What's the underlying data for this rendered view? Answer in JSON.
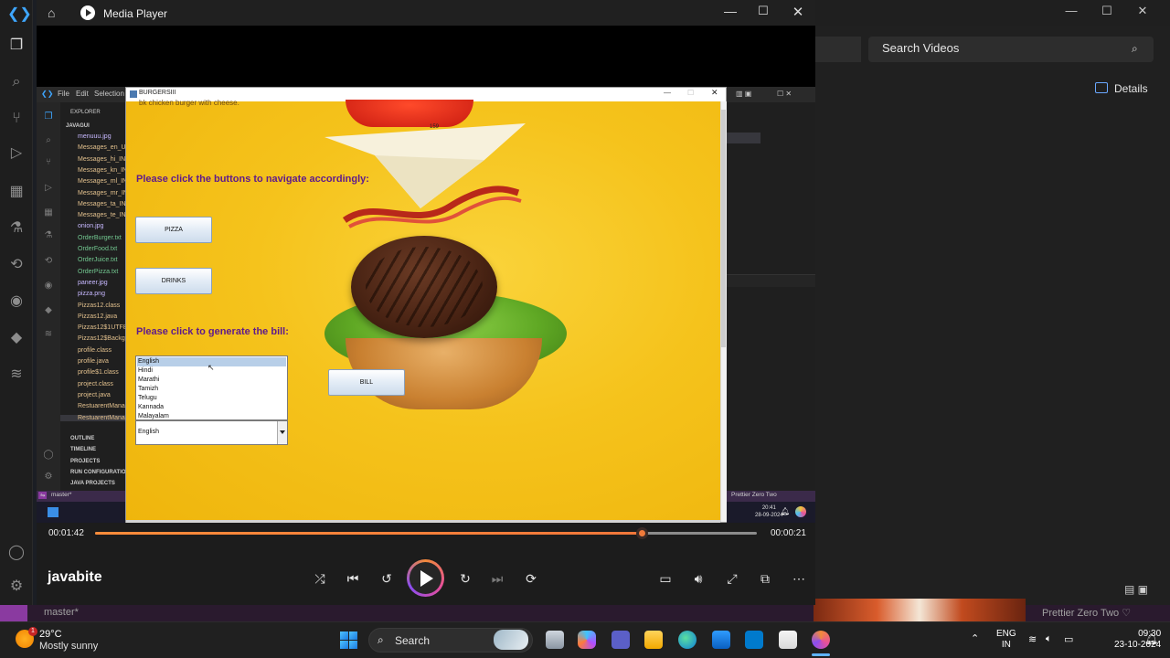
{
  "background_app": {
    "search_placeholder": "Search Videos",
    "details_label": "Details",
    "status_left": "master*",
    "status_right": "Prettier   Zero Two ♡"
  },
  "media_player": {
    "app_title": "Media Player",
    "media_title": "javabite",
    "time_current": "00:01:42",
    "time_remaining": "00:00:21",
    "progress_fraction": 0.828,
    "accent": "#f07a3a"
  },
  "video_frame": {
    "vscode": {
      "menu": [
        "File",
        "Edit",
        "Selection"
      ],
      "explorer_title": "EXPLORER",
      "root_folder": "JAVAGUI",
      "files": [
        {
          "name": "menuuu.jpg",
          "color": "#c7b8ff"
        },
        {
          "name": "Messages_en_US",
          "color": "#e2c08d"
        },
        {
          "name": "Messages_hi_IN",
          "color": "#e2c08d"
        },
        {
          "name": "Messages_kn_IN",
          "color": "#e2c08d"
        },
        {
          "name": "Messages_ml_IN",
          "color": "#e2c08d"
        },
        {
          "name": "Messages_mr_IN",
          "color": "#e2c08d"
        },
        {
          "name": "Messages_ta_IN",
          "color": "#e2c08d"
        },
        {
          "name": "Messages_te_IN",
          "color": "#e2c08d"
        },
        {
          "name": "onion.jpg",
          "color": "#c7b8ff"
        },
        {
          "name": "OrderBurger.txt",
          "color": "#73c991"
        },
        {
          "name": "OrderFood.txt",
          "color": "#73c991"
        },
        {
          "name": "OrderJuice.txt",
          "color": "#73c991"
        },
        {
          "name": "OrderPizza.txt",
          "color": "#73c991"
        },
        {
          "name": "paneer.jpg",
          "color": "#c7b8ff"
        },
        {
          "name": "pizza.png",
          "color": "#c7b8ff"
        },
        {
          "name": "Pizzas12.class",
          "color": "#e2c08d"
        },
        {
          "name": "Pizzas12.java",
          "color": "#e2c08d"
        },
        {
          "name": "Pizzas12$1UTF8",
          "color": "#e2c08d"
        },
        {
          "name": "Pizzas12$Backgr",
          "color": "#e2c08d"
        },
        {
          "name": "profile.class",
          "color": "#e2c08d"
        },
        {
          "name": "profile.java",
          "color": "#e2c08d"
        },
        {
          "name": "profile$1.class",
          "color": "#e2c08d"
        },
        {
          "name": "project.class",
          "color": "#e2c08d"
        },
        {
          "name": "project.java",
          "color": "#e2c08d"
        },
        {
          "name": "RestuarentMana",
          "color": "#e2c08d"
        },
        {
          "name": "RestuarentMana",
          "color": "#e2c08d"
        }
      ],
      "sections": [
        "OUTLINE",
        "TIMELINE",
        "PROJECTS",
        "RUN CONFIGURATIO",
        "JAVA PROJECTS"
      ],
      "status_branch": "master*",
      "status_right": "Prettier   Zero Two",
      "clock_time": "20:41",
      "clock_date": "28-09-2024"
    },
    "java_app": {
      "window_title": "BURGERSIII",
      "subtitle": "bk chicken burger with cheese.",
      "price": "159",
      "navigate_label": "Please click the buttons to navigate accordingly:",
      "pizza_button": "PIZZA",
      "drinks_button": "DRINKS",
      "bill_prompt": "Please click to generate the bill:",
      "bill_button": "BILL",
      "languages": [
        "English",
        "Hindi",
        "Marathi",
        "Tamizh",
        "Telugu",
        "Kannada",
        "Malayalam"
      ],
      "selected_language": "English",
      "label_color": "#5e1a8c",
      "background_color": "#f5c31c"
    }
  },
  "taskbar": {
    "weather_temp": "29°C",
    "weather_desc": "Mostly sunny",
    "weather_badge": "1",
    "search_label": "Search",
    "lang_top": "ENG",
    "lang_bottom": "IN",
    "time": "09:30",
    "date": "23-10-2024"
  }
}
